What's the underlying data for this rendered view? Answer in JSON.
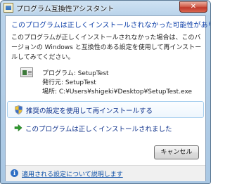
{
  "window": {
    "title": "プログラム互換性アシスタント"
  },
  "dialog": {
    "heading": "このプログラムは正しくインストールされなかった可能性があります",
    "description": "このプログラムが正しくインストールされなかった場合は、このバージョンの Windows と互換性のある設定を使用して再インストールしてみてください。",
    "program_line": "プログラム: SetupTest",
    "publisher_line": "発行元: SetupTest",
    "location_line": "場所: C:¥Users¥shigeki¥Desktop¥SetupTest.exe"
  },
  "options": [
    {
      "label": "推奨の設定を使用して再インストールする",
      "icon": "shield-icon"
    },
    {
      "label": "このプログラムは正しくインストールされました",
      "icon": "green-arrow-icon"
    }
  ],
  "buttons": {
    "cancel": "キャンセル"
  },
  "footer": {
    "help_link": "適用される設定について説明します",
    "icon": "info-icon"
  },
  "colors": {
    "heading": "#0d3fa8",
    "link": "#0b4fa8",
    "arrow": "#2e9b2e"
  }
}
